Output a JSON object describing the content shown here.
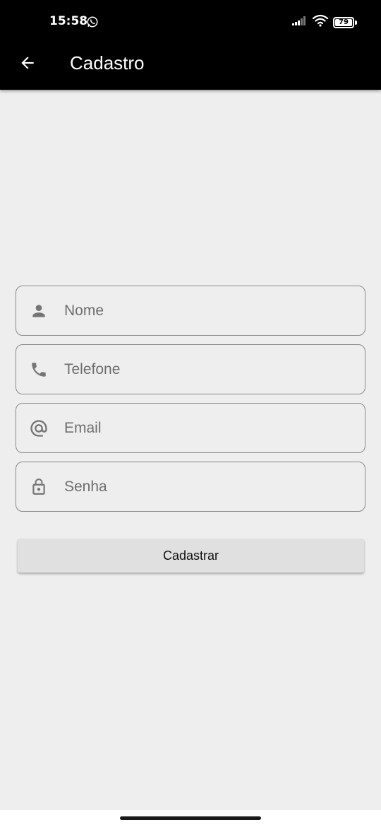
{
  "status_bar": {
    "time": "15:58",
    "battery_level": "79",
    "icons": [
      "whatsapp-icon",
      "signal-icon",
      "wifi-icon",
      "battery-icon"
    ]
  },
  "app_bar": {
    "title": "Cadastro",
    "back_icon": "arrow-back-icon"
  },
  "form": {
    "fields": [
      {
        "placeholder": "Nome",
        "icon": "person-icon",
        "value": ""
      },
      {
        "placeholder": "Telefone",
        "icon": "phone-icon",
        "value": ""
      },
      {
        "placeholder": "Email",
        "icon": "at-sign-icon",
        "value": ""
      },
      {
        "placeholder": "Senha",
        "icon": "lock-icon",
        "value": ""
      }
    ],
    "submit_label": "Cadastrar"
  },
  "colors": {
    "app_bar": "#000000",
    "background": "#eeeeee",
    "field_border": "#8a8a8a",
    "icon": "#757575",
    "button": "#e0e0e0"
  }
}
